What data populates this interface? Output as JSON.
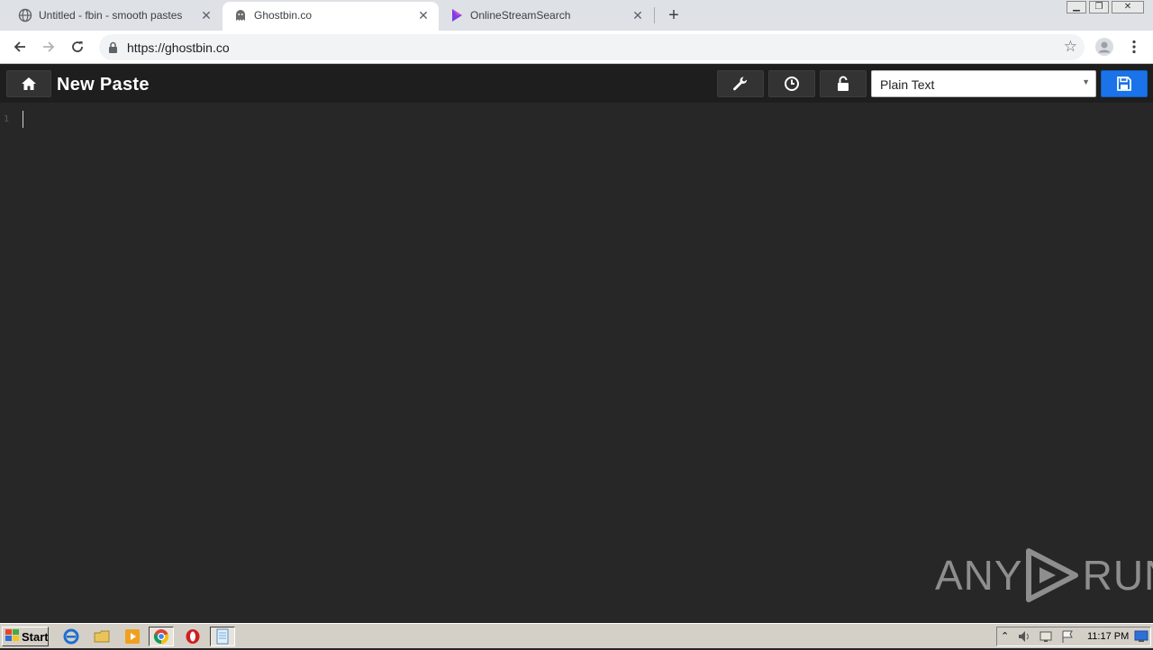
{
  "browser": {
    "tabs": [
      {
        "title": "Untitled - fbin - smooth pastes",
        "active": false,
        "icon": "globe-icon"
      },
      {
        "title": "Ghostbin.co",
        "active": true,
        "icon": "ghost-icon"
      },
      {
        "title": "OnlineStreamSearch",
        "active": false,
        "icon": "play-icon"
      }
    ],
    "new_tab_label": "+",
    "close_label": "✕",
    "url": "https://ghostbin.co",
    "window_controls": [
      "minimize",
      "restore",
      "close"
    ]
  },
  "ghostbin": {
    "page_title": "New Paste",
    "language_value": "Plain Text",
    "buttons": [
      "home-icon",
      "wrench-icon",
      "clock-icon",
      "unlock-icon",
      "save-icon"
    ]
  },
  "editor": {
    "line_numbers": [
      "1"
    ]
  },
  "watermark": {
    "left": "ANY",
    "right": "RUN"
  },
  "taskbar": {
    "start_label": "Start",
    "clock": "11:17 PM"
  },
  "colors": {
    "editor_bg": "#272727",
    "header_bg": "#1e1e1e",
    "save_blue": "#1a73e8",
    "tab_strip": "#dee1e6"
  }
}
